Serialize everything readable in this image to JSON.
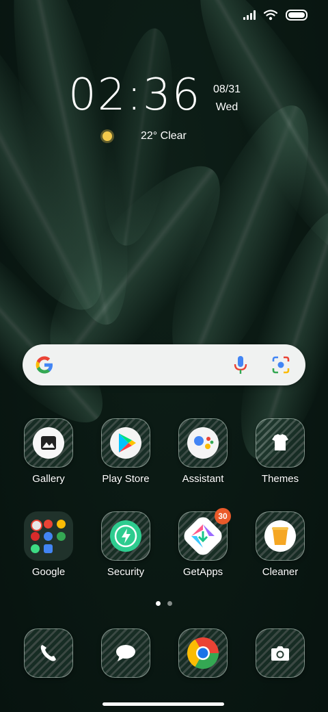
{
  "status_bar": {
    "signal_icon": "signal-icon",
    "wifi_icon": "wifi-icon",
    "battery_icon": "battery-icon"
  },
  "clock": {
    "time": "02:36",
    "date": "08/31",
    "day": "Wed"
  },
  "weather": {
    "icon": "sun-icon",
    "text": "22° Clear"
  },
  "search": {
    "logo": "G",
    "mic_icon": "mic-icon",
    "lens_icon": "lens-icon"
  },
  "apps_row1": [
    {
      "label": "Gallery",
      "icon": "gallery-icon"
    },
    {
      "label": "Play Store",
      "icon": "play-store-icon"
    },
    {
      "label": "Assistant",
      "icon": "assistant-icon"
    },
    {
      "label": "Themes",
      "icon": "themes-icon"
    }
  ],
  "apps_row2": [
    {
      "label": "Google",
      "icon": "google-folder-icon"
    },
    {
      "label": "Security",
      "icon": "security-icon"
    },
    {
      "label": "GetApps",
      "icon": "getapps-icon",
      "badge": "30"
    },
    {
      "label": "Cleaner",
      "icon": "cleaner-icon"
    }
  ],
  "page_indicator": {
    "pages": 2,
    "current": 1
  },
  "dock": [
    {
      "icon": "phone-icon"
    },
    {
      "icon": "messages-icon"
    },
    {
      "icon": "chrome-icon"
    },
    {
      "icon": "camera-icon"
    }
  ],
  "colors": {
    "badge": "#ea5a2a",
    "search_bg": "#f0f2f1"
  }
}
